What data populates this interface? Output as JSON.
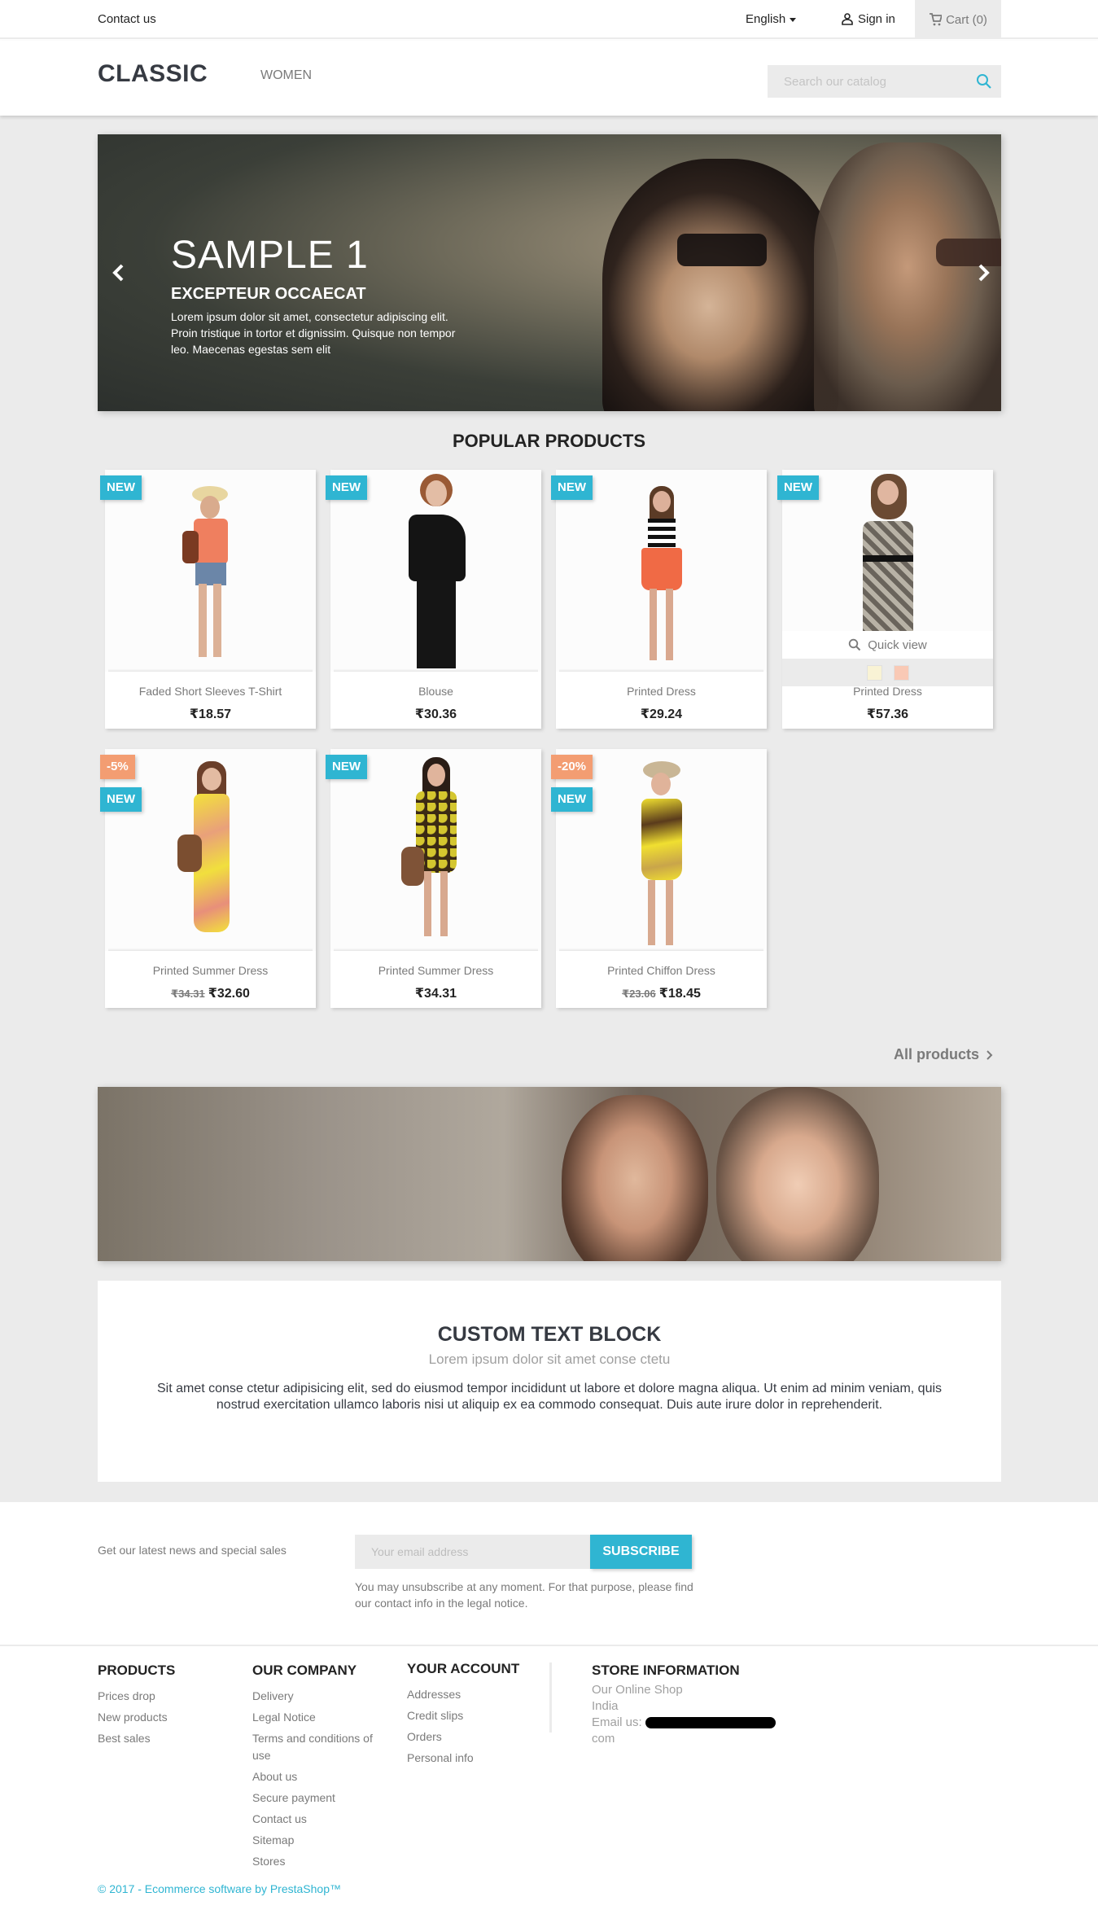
{
  "topbar": {
    "contact": "Contact us",
    "language": "English",
    "sign_in": "Sign in",
    "cart": "Cart (0)"
  },
  "header": {
    "logo": "CLASSIC",
    "menu": [
      "WOMEN"
    ],
    "search_placeholder": "Search our catalog"
  },
  "hero": {
    "title": "SAMPLE 1",
    "subtitle": "EXCEPTEUR OCCAECAT",
    "text": "Lorem ipsum dolor sit amet, consectetur adipiscing elit. Proin tristique in tortor et dignissim. Quisque non tempor leo. Maecenas egestas sem elit"
  },
  "popular": {
    "title": "POPULAR PRODUCTS",
    "all_products": "All products",
    "quick_view": "Quick view",
    "products": [
      {
        "name": "Faded Short Sleeves T-Shirt",
        "price": "₹18.57",
        "regular_price": "",
        "badges": [
          "NEW"
        ]
      },
      {
        "name": "Blouse",
        "price": "₹30.36",
        "regular_price": "",
        "badges": [
          "NEW"
        ]
      },
      {
        "name": "Printed Dress",
        "price": "₹29.24",
        "regular_price": "",
        "badges": [
          "NEW"
        ]
      },
      {
        "name": "Printed Dress",
        "price": "₹57.36",
        "regular_price": "",
        "badges": [
          "NEW"
        ],
        "swatches": [
          "#f9f3d5",
          "#f9c9b5"
        ]
      },
      {
        "name": "Printed Summer Dress",
        "price": "₹32.60",
        "regular_price": "₹34.31",
        "discount": "-5%",
        "badges": [
          "NEW"
        ]
      },
      {
        "name": "Printed Summer Dress",
        "price": "₹34.31",
        "regular_price": "",
        "badges": [
          "NEW"
        ]
      },
      {
        "name": "Printed Chiffon Dress",
        "price": "₹18.45",
        "regular_price": "₹23.06",
        "discount": "-20%",
        "badges": [
          "NEW"
        ]
      }
    ]
  },
  "custom_block": {
    "title": "CUSTOM TEXT BLOCK",
    "subtitle": "Lorem ipsum dolor sit amet conse ctetu",
    "text": "Sit amet conse ctetur adipisicing elit, sed do eiusmod tempor incididunt ut labore et dolore magna aliqua. Ut enim ad minim veniam, quis nostrud exercitation ullamco laboris nisi ut aliquip ex ea commodo consequat. Duis aute irure dolor in reprehenderit."
  },
  "newsletter": {
    "label": "Get our latest news and special sales",
    "email_placeholder": "Your email address",
    "subscribe": "SUBSCRIBE",
    "note": "You may unsubscribe at any moment. For that purpose, please find our contact info in the legal notice."
  },
  "footer": {
    "products": {
      "title": "PRODUCTS",
      "links": [
        "Prices drop",
        "New products",
        "Best sales"
      ]
    },
    "company": {
      "title": "OUR COMPANY",
      "links": [
        "Delivery",
        "Legal Notice",
        "Terms and conditions of use",
        "About us",
        "Secure payment",
        "Contact us",
        "Sitemap",
        "Stores"
      ]
    },
    "account": {
      "title": "YOUR ACCOUNT",
      "links": [
        "Addresses",
        "Credit slips",
        "Orders",
        "Personal info"
      ]
    },
    "store": {
      "title": "STORE INFORMATION",
      "name": "Our Online Shop",
      "country": "India",
      "email_label": "Email us:",
      "email_suffix": "com"
    },
    "copyright": "© 2017 - Ecommerce software by PrestaShop™"
  },
  "colors": {
    "accent": "#2fb5d2",
    "discount": "#f39d72",
    "background": "#ebebeb"
  }
}
